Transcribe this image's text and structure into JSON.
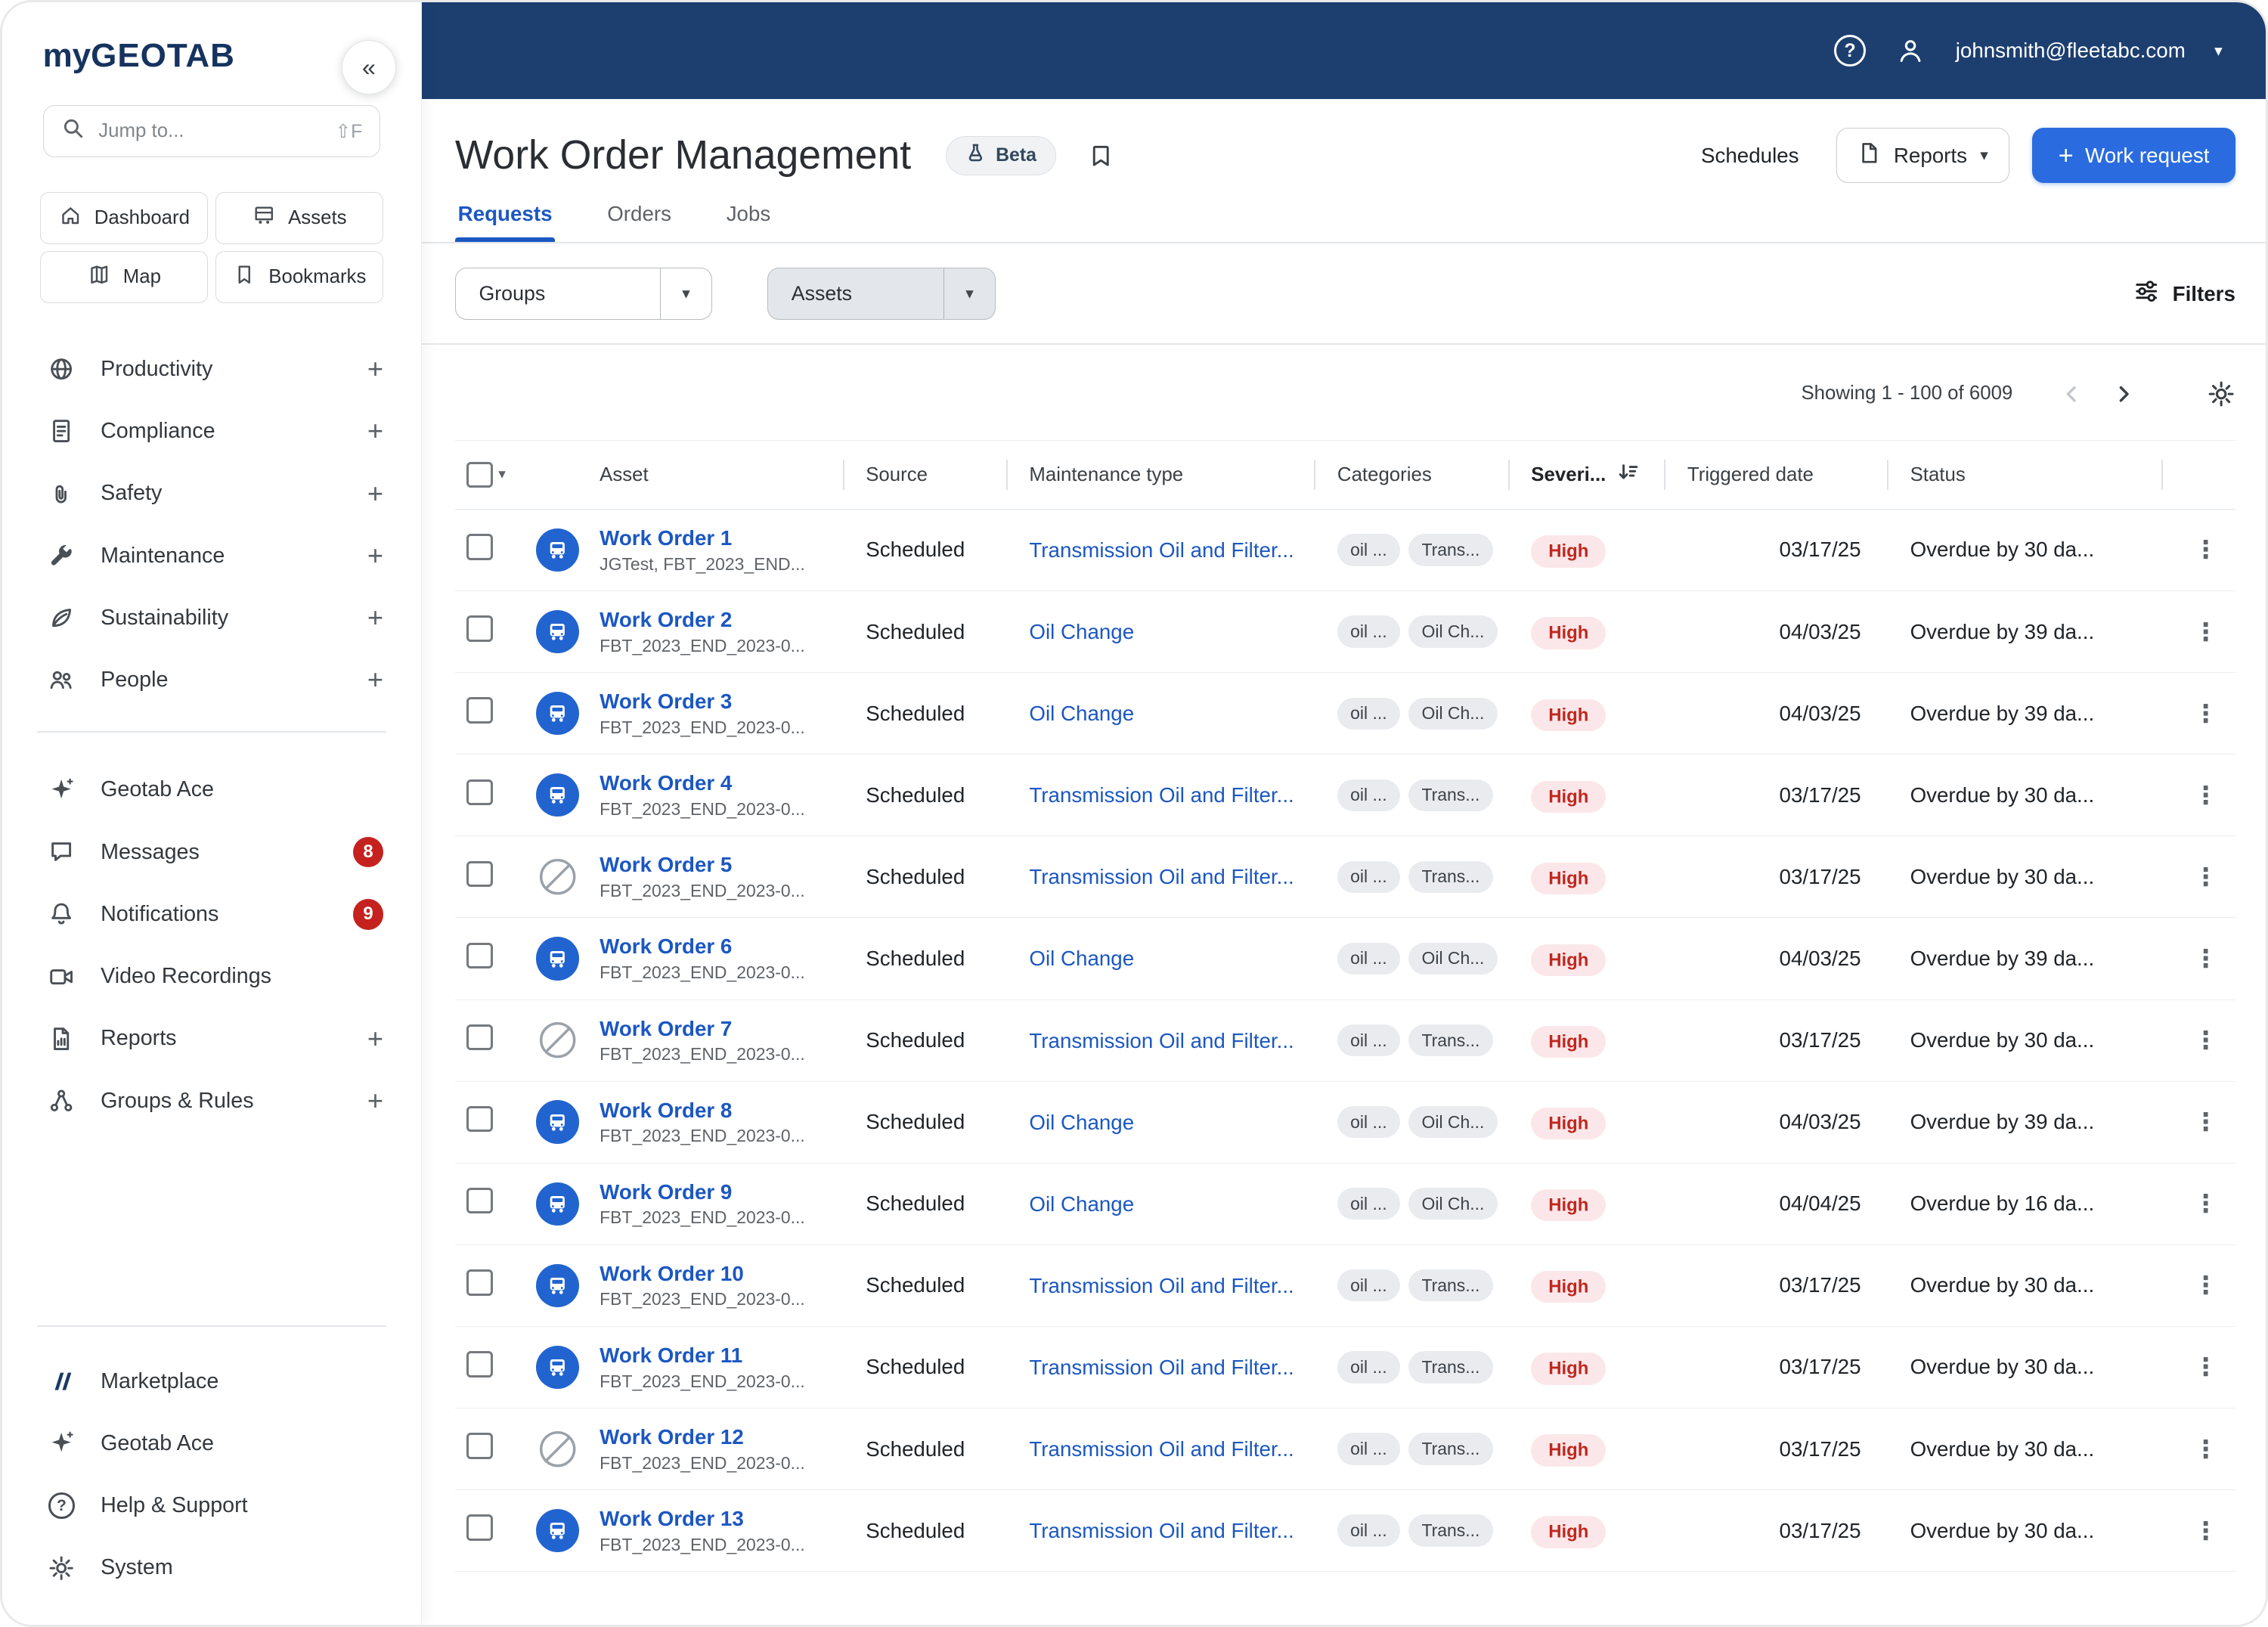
{
  "glyphs": {
    "caret": "▾",
    "collapse": "«",
    "expand": "+",
    "help": "?",
    "kebab": "⋮"
  },
  "topbar": {
    "email": "johnsmith@fleetabc.com"
  },
  "sidebar": {
    "logo_my": "my",
    "logo_geotab": "GEOTAB",
    "search": {
      "placeholder": "Jump to...",
      "shortcut": "⇧F"
    },
    "quick": [
      {
        "label": "Dashboard"
      },
      {
        "label": "Assets"
      },
      {
        "label": "Map"
      },
      {
        "label": "Bookmarks"
      }
    ],
    "nav": [
      {
        "label": "Productivity"
      },
      {
        "label": "Compliance"
      },
      {
        "label": "Safety"
      },
      {
        "label": "Maintenance"
      },
      {
        "label": "Sustainability"
      },
      {
        "label": "People"
      }
    ],
    "tools": [
      {
        "label": "Geotab Ace"
      },
      {
        "label": "Messages",
        "badge": "8"
      },
      {
        "label": "Notifications",
        "badge": "9"
      },
      {
        "label": "Video Recordings"
      },
      {
        "label": "Reports"
      },
      {
        "label": "Groups & Rules"
      }
    ],
    "bottom": [
      {
        "label": "Marketplace"
      },
      {
        "label": "Geotab Ace"
      },
      {
        "label": "Help & Support"
      },
      {
        "label": "System"
      }
    ]
  },
  "page": {
    "title": "Work Order Management",
    "beta_label": "Beta",
    "schedules_label": "Schedules",
    "reports_label": "Reports",
    "work_request_label": "Work request"
  },
  "tabs": [
    {
      "label": "Requests"
    },
    {
      "label": "Orders"
    },
    {
      "label": "Jobs"
    }
  ],
  "filterbar": {
    "groups_label": "Groups",
    "assets_label": "Assets",
    "filters_label": "Filters"
  },
  "pagination": {
    "summary": "Showing 1 - 100 of 6009"
  },
  "table": {
    "columns": {
      "asset": "Asset",
      "source": "Source",
      "maintenance": "Maintenance type",
      "categories": "Categories",
      "severity": "Severi...",
      "triggered": "Triggered date",
      "status": "Status"
    },
    "rows": [
      {
        "name": "Work Order 1",
        "sub": "JGTest, FBT_2023_END...",
        "source": "Scheduled",
        "type": "Transmission Oil and Filter...",
        "categories": [
          "oil ...",
          "Trans..."
        ],
        "severity": "High",
        "date": "03/17/25",
        "status": "Overdue by 30 da...",
        "icon": "vehicle"
      },
      {
        "name": "Work Order 2",
        "sub": "FBT_2023_END_2023-0...",
        "source": "Scheduled",
        "type": "Oil Change",
        "categories": [
          "oil ...",
          "Oil Ch..."
        ],
        "severity": "High",
        "date": "04/03/25",
        "status": "Overdue by 39 da...",
        "icon": "vehicle"
      },
      {
        "name": "Work Order 3",
        "sub": "FBT_2023_END_2023-0...",
        "source": "Scheduled",
        "type": "Oil Change",
        "categories": [
          "oil ...",
          "Oil Ch..."
        ],
        "severity": "High",
        "date": "04/03/25",
        "status": "Overdue by 39 da...",
        "icon": "vehicle"
      },
      {
        "name": "Work Order 4",
        "sub": "FBT_2023_END_2023-0...",
        "source": "Scheduled",
        "type": "Transmission Oil and Filter...",
        "categories": [
          "oil ...",
          "Trans..."
        ],
        "severity": "High",
        "date": "03/17/25",
        "status": "Overdue by 30 da...",
        "icon": "vehicle"
      },
      {
        "name": "Work Order 5",
        "sub": "FBT_2023_END_2023-0...",
        "source": "Scheduled",
        "type": "Transmission Oil and Filter...",
        "categories": [
          "oil ...",
          "Trans..."
        ],
        "severity": "High",
        "date": "03/17/25",
        "status": "Overdue by 30 da...",
        "icon": "nodevice"
      },
      {
        "name": "Work Order 6",
        "sub": "FBT_2023_END_2023-0...",
        "source": "Scheduled",
        "type": "Oil Change",
        "categories": [
          "oil ...",
          "Oil Ch..."
        ],
        "severity": "High",
        "date": "04/03/25",
        "status": "Overdue by 39 da...",
        "icon": "vehicle"
      },
      {
        "name": "Work Order 7",
        "sub": "FBT_2023_END_2023-0...",
        "source": "Scheduled",
        "type": "Transmission Oil and Filter...",
        "categories": [
          "oil ...",
          "Trans..."
        ],
        "severity": "High",
        "date": "03/17/25",
        "status": "Overdue by 30 da...",
        "icon": "nodevice"
      },
      {
        "name": "Work Order 8",
        "sub": "FBT_2023_END_2023-0...",
        "source": "Scheduled",
        "type": "Oil Change",
        "categories": [
          "oil ...",
          "Oil Ch..."
        ],
        "severity": "High",
        "date": "04/03/25",
        "status": "Overdue by 39 da...",
        "icon": "vehicle"
      },
      {
        "name": "Work Order 9",
        "sub": "FBT_2023_END_2023-0...",
        "source": "Scheduled",
        "type": "Oil Change",
        "categories": [
          "oil ...",
          "Oil Ch..."
        ],
        "severity": "High",
        "date": "04/04/25",
        "status": "Overdue by 16 da...",
        "icon": "vehicle"
      },
      {
        "name": "Work Order 10",
        "sub": "FBT_2023_END_2023-0...",
        "source": "Scheduled",
        "type": "Transmission Oil and Filter...",
        "categories": [
          "oil ...",
          "Trans..."
        ],
        "severity": "High",
        "date": "03/17/25",
        "status": "Overdue by 30 da...",
        "icon": "vehicle"
      },
      {
        "name": "Work Order 11",
        "sub": "FBT_2023_END_2023-0...",
        "source": "Scheduled",
        "type": "Transmission Oil and Filter...",
        "categories": [
          "oil ...",
          "Trans..."
        ],
        "severity": "High",
        "date": "03/17/25",
        "status": "Overdue by 30 da...",
        "icon": "vehicle"
      },
      {
        "name": "Work Order 12",
        "sub": "FBT_2023_END_2023-0...",
        "source": "Scheduled",
        "type": "Transmission Oil and Filter...",
        "categories": [
          "oil ...",
          "Trans..."
        ],
        "severity": "High",
        "date": "03/17/25",
        "status": "Overdue by 30 da...",
        "icon": "nodevice"
      },
      {
        "name": "Work Order 13",
        "sub": "FBT_2023_END_2023-0...",
        "source": "Scheduled",
        "type": "Transmission Oil and Filter...",
        "categories": [
          "oil ...",
          "Trans..."
        ],
        "severity": "High",
        "date": "03/17/25",
        "status": "Overdue by 30 da...",
        "icon": "vehicle"
      }
    ]
  }
}
